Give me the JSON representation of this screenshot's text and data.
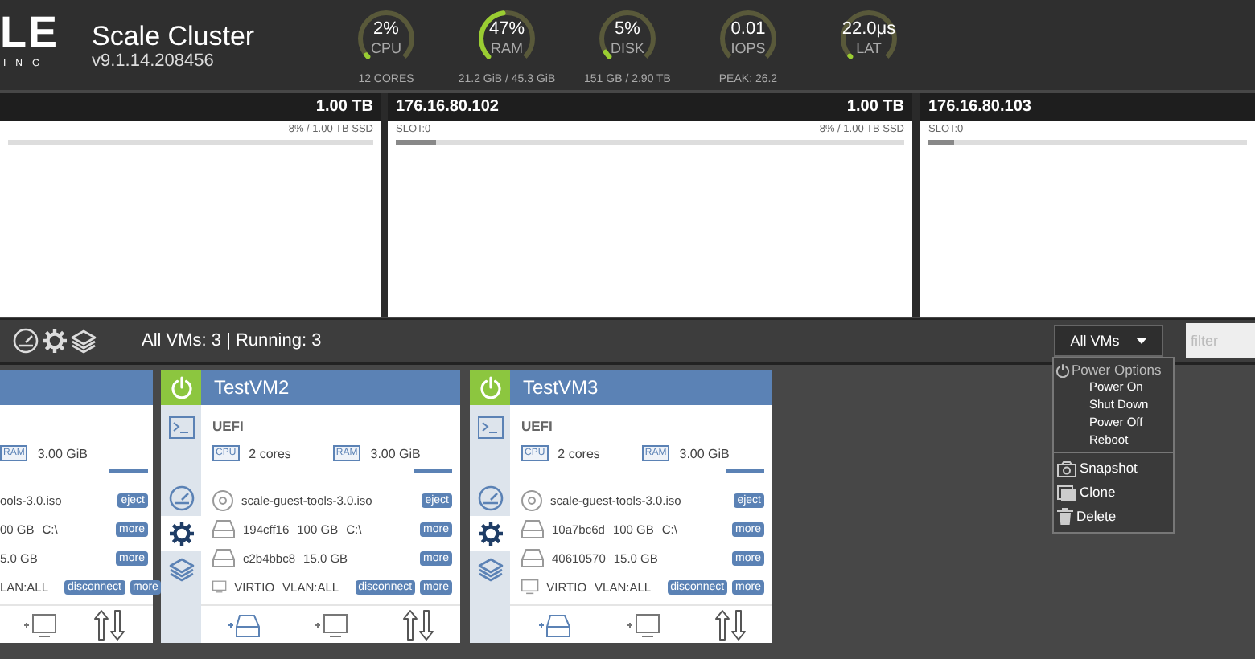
{
  "header": {
    "logo": "LE",
    "logo_sub": "ING",
    "title": "Scale Cluster",
    "version": "v9.1.14.208456"
  },
  "gauges": [
    {
      "value": "2%",
      "label": "CPU",
      "caption": "12 CORES",
      "level": 0.02
    },
    {
      "value": "47%",
      "label": "RAM",
      "caption": "21.2 GiB / 45.3 GiB",
      "level": 0.47
    },
    {
      "value": "5%",
      "label": "DISK",
      "caption": "151 GB / 2.90 TB",
      "level": 0.05
    },
    {
      "value": "0.01",
      "label": "IOPS",
      "caption": "PEAK: 26.2"
    },
    {
      "value": "22.0μs",
      "label": "LAT",
      "level": 0.01
    }
  ],
  "nodes": [
    {
      "capacity": "1.00 TB",
      "usage": "8% / 1.00 TB SSD"
    },
    {
      "ip": "176.16.80.102",
      "capacity": "1.00 TB",
      "slot": "SLOT:0",
      "usage": "8% / 1.00 TB SSD",
      "level": 0.08
    },
    {
      "ip": "176.16.80.103",
      "slot": "SLOT:0",
      "level": 0.08
    }
  ],
  "toolbar": {
    "summary": "All VMs: 3 | Running: 3",
    "select": "All VMs",
    "filter": {
      "placeholder": "filter"
    }
  },
  "menu": {
    "groups": [
      {
        "kind": "submenu",
        "label": "Power Options",
        "items": [
          {
            "label": "Power On"
          },
          {
            "label": "Shut Down"
          },
          {
            "label": "Power Off"
          },
          {
            "label": "Reboot"
          }
        ]
      },
      {
        "kind": "actions",
        "items": [
          {
            "label": "Snapshot"
          },
          {
            "label": "Clone"
          },
          {
            "label": "Delete"
          }
        ]
      }
    ]
  },
  "vms": [
    {
      "kind": "cut",
      "ram": {
        "badge": "RAM",
        "value": "3.00 GiB"
      },
      "devices": [
        {
          "texts": [
            "ools-3.0.iso"
          ],
          "actions": [
            "eject"
          ]
        },
        {
          "texts": [
            "00 GB",
            "C:\\"
          ],
          "actions": [
            "more"
          ]
        },
        {
          "texts": [
            "5.0 GB"
          ],
          "actions": [
            "more"
          ]
        },
        {
          "texts": [
            "LAN:ALL"
          ],
          "actions": [
            "disconnect",
            "more"
          ]
        }
      ]
    },
    {
      "kind": "full",
      "powered": true,
      "title": "TestVM2",
      "boot": "UEFI",
      "cpu": {
        "badge": "CPU",
        "value": "2 cores"
      },
      "ram": {
        "badge": "RAM",
        "value": "3.00 GiB"
      },
      "side_tabs": [
        {
          "selected": false
        },
        {
          "selected": false
        },
        {
          "selected": true
        },
        {
          "selected": false
        }
      ],
      "devices": [
        {
          "kind": "cdrom",
          "texts": [
            "scale-guest-tools-3.0.iso"
          ],
          "actions": [
            "eject"
          ]
        },
        {
          "kind": "disk",
          "texts": [
            "194cff16",
            "100 GB",
            "C:\\"
          ],
          "actions": [
            "more"
          ]
        },
        {
          "kind": "disk",
          "texts": [
            "c2b4bbc8",
            "15.0 GB"
          ],
          "actions": [
            "more"
          ]
        },
        {
          "kind": "nic",
          "texts": [
            "VIRTIO",
            "VLAN:ALL"
          ],
          "actions": [
            "disconnect",
            "more"
          ]
        }
      ]
    },
    {
      "kind": "full",
      "powered": true,
      "title": "TestVM3",
      "boot": "UEFI",
      "cpu": {
        "badge": "CPU",
        "value": "2 cores"
      },
      "ram": {
        "badge": "RAM",
        "value": "3.00 GiB"
      },
      "side_tabs": [
        {
          "selected": false
        },
        {
          "selected": false
        },
        {
          "selected": true
        },
        {
          "selected": false
        }
      ],
      "devices": [
        {
          "kind": "cdrom",
          "texts": [
            "scale-guest-tools-3.0.iso"
          ],
          "actions": [
            "eject"
          ]
        },
        {
          "kind": "disk",
          "texts": [
            "10a7bc6d",
            "100 GB",
            "C:\\"
          ],
          "actions": [
            "more"
          ]
        },
        {
          "kind": "disk",
          "texts": [
            "40610570",
            "15.0 GB"
          ],
          "actions": [
            "more"
          ]
        },
        {
          "kind": "nic",
          "texts": [
            "VIRTIO",
            "VLAN:ALL"
          ],
          "actions": [
            "disconnect",
            "more"
          ]
        }
      ]
    }
  ]
}
